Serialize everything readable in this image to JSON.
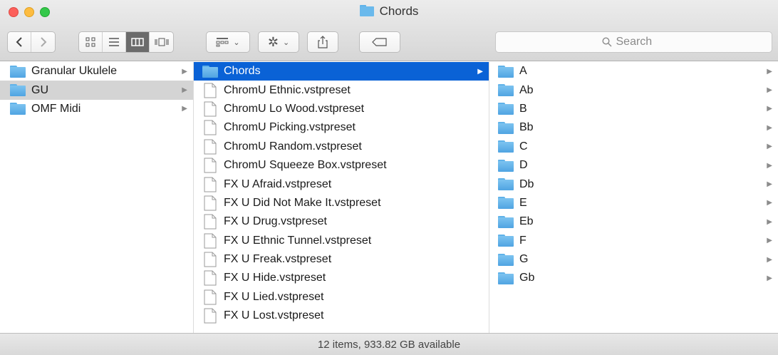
{
  "window": {
    "title": "Chords",
    "search_placeholder": "Search"
  },
  "columns": {
    "col1": [
      {
        "label": "Granular Ukulele",
        "type": "folder",
        "has_children": true
      },
      {
        "label": "GU",
        "type": "folder",
        "has_children": true,
        "selected": "gray"
      },
      {
        "label": "OMF Midi",
        "type": "folder",
        "has_children": true
      }
    ],
    "col2": [
      {
        "label": "Chords",
        "type": "folder",
        "has_children": true,
        "selected": "blue"
      },
      {
        "label": "ChromU Ethnic.vstpreset",
        "type": "file"
      },
      {
        "label": "ChromU Lo Wood.vstpreset",
        "type": "file"
      },
      {
        "label": "ChromU Picking.vstpreset",
        "type": "file"
      },
      {
        "label": "ChromU Random.vstpreset",
        "type": "file"
      },
      {
        "label": "ChromU Squeeze Box.vstpreset",
        "type": "file"
      },
      {
        "label": "FX U Afraid.vstpreset",
        "type": "file"
      },
      {
        "label": "FX U Did Not Make It.vstpreset",
        "type": "file"
      },
      {
        "label": "FX U Drug.vstpreset",
        "type": "file"
      },
      {
        "label": "FX U Ethnic Tunnel.vstpreset",
        "type": "file"
      },
      {
        "label": "FX U Freak.vstpreset",
        "type": "file"
      },
      {
        "label": "FX U Hide.vstpreset",
        "type": "file"
      },
      {
        "label": "FX U Lied.vstpreset",
        "type": "file"
      },
      {
        "label": "FX U Lost.vstpreset",
        "type": "file"
      }
    ],
    "col3": [
      {
        "label": "A",
        "type": "folder",
        "has_children": true
      },
      {
        "label": "Ab",
        "type": "folder",
        "has_children": true
      },
      {
        "label": "B",
        "type": "folder",
        "has_children": true
      },
      {
        "label": "Bb",
        "type": "folder",
        "has_children": true
      },
      {
        "label": "C",
        "type": "folder",
        "has_children": true
      },
      {
        "label": "D",
        "type": "folder",
        "has_children": true
      },
      {
        "label": "Db",
        "type": "folder",
        "has_children": true
      },
      {
        "label": "E",
        "type": "folder",
        "has_children": true
      },
      {
        "label": "Eb",
        "type": "folder",
        "has_children": true
      },
      {
        "label": "F",
        "type": "folder",
        "has_children": true
      },
      {
        "label": "G",
        "type": "folder",
        "has_children": true
      },
      {
        "label": "Gb",
        "type": "folder",
        "has_children": true
      }
    ]
  },
  "status": {
    "text": "12 items, 933.82 GB available"
  },
  "colors": {
    "selection_blue": "#0a62d6",
    "selection_gray": "#d4d4d4",
    "folder_blue": "#5fb2e9"
  },
  "icons": {
    "toolbar": [
      "back-icon",
      "forward-icon",
      "icon-view-icon",
      "list-view-icon",
      "column-view-icon",
      "cover-flow-icon",
      "arrange-icon",
      "gear-icon",
      "share-icon",
      "tag-icon",
      "search-icon"
    ]
  }
}
